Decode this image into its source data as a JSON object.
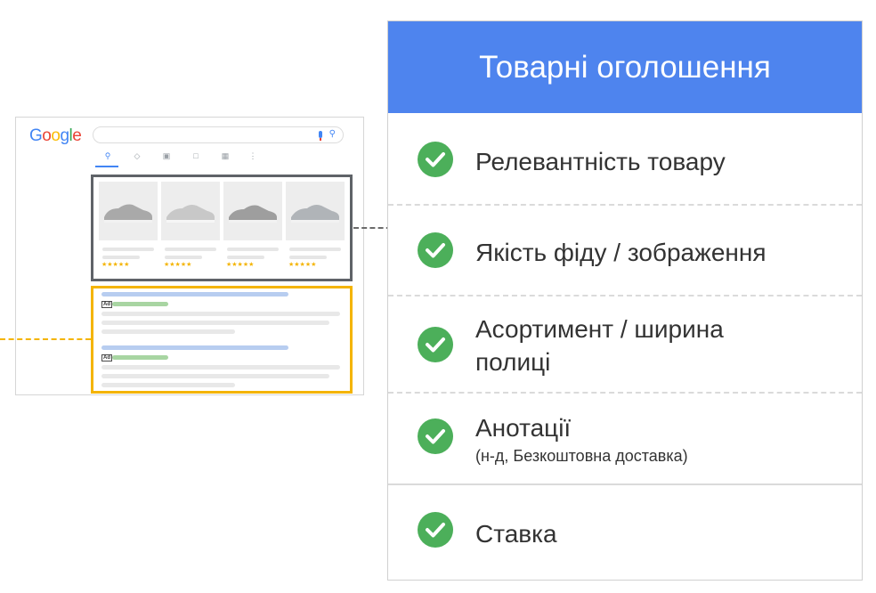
{
  "serp": {
    "logo": [
      {
        "ch": "G",
        "color": "#4285f4"
      },
      {
        "ch": "o",
        "color": "#ea4335"
      },
      {
        "ch": "o",
        "color": "#fbbc05"
      },
      {
        "ch": "g",
        "color": "#4285f4"
      },
      {
        "ch": "l",
        "color": "#34a853"
      },
      {
        "ch": "e",
        "color": "#ea4335"
      }
    ],
    "ad_tag": "Ad",
    "stars": "★★★★★"
  },
  "panel": {
    "title": "Товарні оголошення",
    "items": [
      {
        "label": "Релевантність товару"
      },
      {
        "label": "Якість фіду / зображення"
      },
      {
        "label": "Асортимент / ширина полиці"
      },
      {
        "label": "Анотації",
        "sub": "(н-д, Безкоштовна доставка)"
      },
      {
        "label": "Ставка"
      }
    ]
  },
  "colors": {
    "header": "#4e84ee",
    "check": "#4caf5a",
    "shopping_box": "#5f6368",
    "ads_box": "#f4b400"
  }
}
